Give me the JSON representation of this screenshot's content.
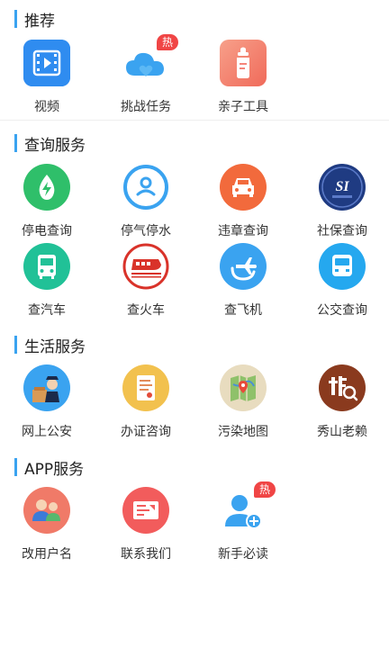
{
  "sections": [
    {
      "title": "推荐",
      "items": [
        {
          "label": "视频",
          "icon": "video-icon",
          "color": "#2f8cf0"
        },
        {
          "label": "挑战任务",
          "icon": "cloud-heart-icon",
          "color": "#3aa3f0",
          "badge": "热"
        },
        {
          "label": "亲子工具",
          "icon": "baby-bottle-icon",
          "color": "#f07a68"
        }
      ]
    },
    {
      "title": "查询服务",
      "items": [
        {
          "label": "停电查询",
          "icon": "power-leaf-icon",
          "color": "#2fbf6a"
        },
        {
          "label": "停气停水",
          "icon": "water-drop-icon",
          "color": "#3aa3f0"
        },
        {
          "label": "违章查询",
          "icon": "car-icon",
          "color": "#f26a3c"
        },
        {
          "label": "社保查询",
          "icon": "social-security-logo",
          "color": "#1f3b82"
        },
        {
          "label": "查汽车",
          "icon": "bus-icon",
          "color": "#21c197"
        },
        {
          "label": "查火车",
          "icon": "train-icon",
          "color": "#d9332a"
        },
        {
          "label": "查飞机",
          "icon": "plane-icon",
          "color": "#3aa3f0"
        },
        {
          "label": "公交查询",
          "icon": "bus-icon",
          "color": "#25a8ef"
        }
      ]
    },
    {
      "title": "生活服务",
      "items": [
        {
          "label": "网上公安",
          "icon": "police-icon",
          "color": "#3aa3f0"
        },
        {
          "label": "办证咨询",
          "icon": "certificate-icon",
          "color": "#f2c14e"
        },
        {
          "label": "污染地图",
          "icon": "map-icon",
          "color": "#d8c7a0"
        },
        {
          "label": "秀山老赖",
          "icon": "debtor-search-icon",
          "color": "#8a3a1e"
        }
      ]
    },
    {
      "title": "APP服务",
      "items": [
        {
          "label": "改用户名",
          "icon": "users-icon",
          "color": "#f07a68"
        },
        {
          "label": "联系我们",
          "icon": "contact-card-icon",
          "color": "#f25c5c"
        },
        {
          "label": "新手必读",
          "icon": "user-add-icon",
          "color": "#3aa3f0",
          "badge": "热"
        }
      ]
    }
  ],
  "svgtext": {
    "social": "SI"
  }
}
